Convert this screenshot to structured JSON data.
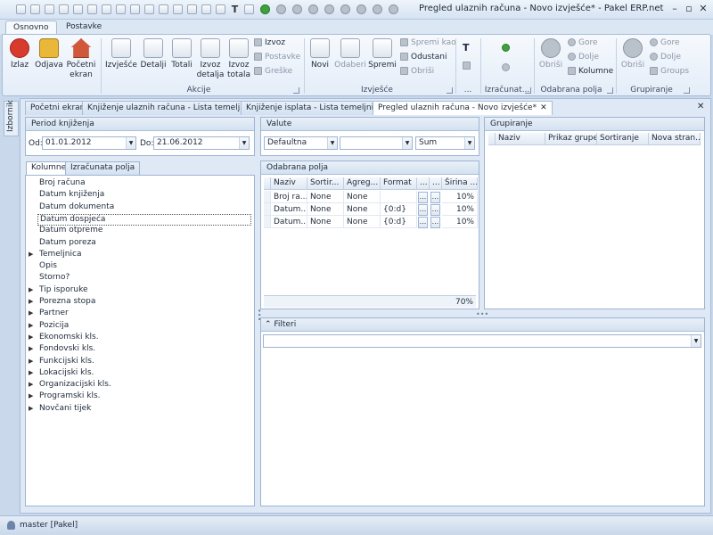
{
  "window": {
    "title": "Pregled ulaznih računa - Novo izvješće* - Pakel ERP.net"
  },
  "ribbon_tabs": [
    "Osnovno",
    "Postavke"
  ],
  "ribbon": {
    "izlaz": "Izlaz",
    "odjava": "Odjava",
    "pocetni_ekran": [
      "Početni",
      "ekran"
    ],
    "akcije": {
      "izvjesce": "Izvješće",
      "detalji": "Detalji",
      "totali": "Totali",
      "izvoz_detalja": [
        "Izvoz",
        "detalja"
      ],
      "izvoz_totala": [
        "Izvoz",
        "totala"
      ],
      "izvoz": "Izvoz",
      "postavke": "Postavke",
      "greske": "Greške"
    },
    "izvjesce": {
      "novi": "Novi",
      "odaberi": "Odaberi",
      "spremi": "Spremi",
      "spremi_kao": "Spremi kao",
      "odustani": "Odustani",
      "obrisi": "Obriši"
    },
    "odabrana_polja": {
      "obrisi": "Obriši",
      "gore": "Gore",
      "dolje": "Dolje",
      "kolumne": "Kolumne"
    },
    "grupiranje": {
      "obrisi": "Obriši",
      "gore": "Gore",
      "dolje": "Dolje",
      "groups": "Groups"
    },
    "groups": {
      "akcije": "Akcije",
      "izvjesce": "Izvješće",
      "more": "...",
      "izracunato": "Izračunat...",
      "odabrana_polja": "Odabrana polja",
      "grupiranje": "Grupiranje"
    }
  },
  "sidebar": {
    "izbornik": "Izbornik"
  },
  "doc_tabs": [
    {
      "label": "Početni ekran"
    },
    {
      "label": "Knjiženje ulaznih računa - Lista temeljnica"
    },
    {
      "label": "Knjiženje isplata - Lista temeljnica"
    },
    {
      "label": "Pregled ulaznih računa - Novo izvješće*"
    }
  ],
  "period": {
    "title": "Period knjiženja",
    "od_label": "Od:",
    "od_value": "01.01.2012",
    "do_label": "Do:",
    "do_value": "21.06.2012"
  },
  "valute": {
    "title": "Valute",
    "currency": "Defaultna",
    "second": "",
    "agg": "Sum"
  },
  "grupiranje_panel": {
    "title": "Grupiranje",
    "columns": [
      "Naziv",
      "Prikaz grupe",
      "Sortiranje",
      "Nova stran..."
    ]
  },
  "fields": {
    "tabs": [
      "Kolumne",
      "Izračunata polja"
    ],
    "items": [
      {
        "label": "Broj računa",
        "expandable": false
      },
      {
        "label": "Datum knjiženja",
        "expandable": false
      },
      {
        "label": "Datum dokumenta",
        "expandable": false
      },
      {
        "label": "Datum dospjeća",
        "expandable": false,
        "selected": true
      },
      {
        "label": "Datum otpreme",
        "expandable": false
      },
      {
        "label": "Datum poreza",
        "expandable": false
      },
      {
        "label": "Temeljnica",
        "expandable": true
      },
      {
        "label": "Opis",
        "expandable": false
      },
      {
        "label": "Storno?",
        "expandable": false
      },
      {
        "label": "Tip isporuke",
        "expandable": true
      },
      {
        "label": "Porezna stopa",
        "expandable": true
      },
      {
        "label": "Partner",
        "expandable": true
      },
      {
        "label": "Pozicija",
        "expandable": true
      },
      {
        "label": "Ekonomski kls.",
        "expandable": true
      },
      {
        "label": "Fondovski kls.",
        "expandable": true
      },
      {
        "label": "Funkcijski kls.",
        "expandable": true
      },
      {
        "label": "Lokacijski kls.",
        "expandable": true
      },
      {
        "label": "Organizacijski kls.",
        "expandable": true
      },
      {
        "label": "Programski kls.",
        "expandable": true
      },
      {
        "label": "Novčani tijek",
        "expandable": true
      }
    ]
  },
  "odabrana": {
    "title": "Odabrana polja",
    "columns": [
      "Naziv",
      "Sortir...",
      "Agreg...",
      "Format",
      "...",
      "...",
      "Širina ..."
    ],
    "rows": [
      [
        "Broj ra...",
        "None",
        "None",
        "",
        "...",
        "...",
        "10%"
      ],
      [
        "Datum...",
        "None",
        "None",
        "{0:d}",
        "...",
        "...",
        "10%"
      ],
      [
        "Datum...",
        "None",
        "None",
        "{0:d}",
        "...",
        "...",
        "10%"
      ]
    ],
    "total_width": "70%"
  },
  "filteri": {
    "title": "Filteri",
    "value": ""
  },
  "status": {
    "user": "master [Pakel]"
  }
}
